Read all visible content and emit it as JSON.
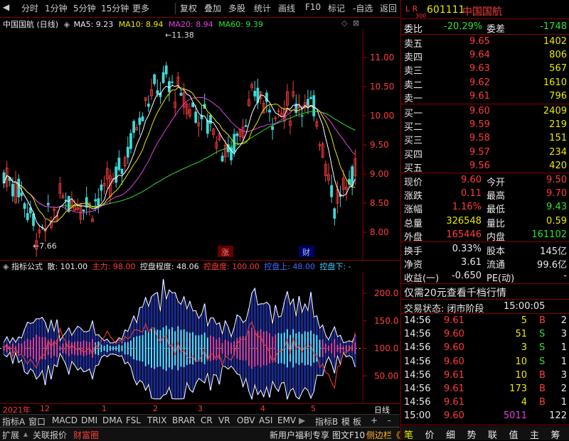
{
  "toolbar": {
    "items": [
      "分时",
      "1分钟",
      "5分钟",
      "15分钟",
      "更多",
      "复权",
      "叠加",
      "多股",
      "统计",
      "画线",
      "F10",
      "标记",
      "-自选",
      "返回"
    ]
  },
  "main_chart": {
    "title": "中国国航 (日线)",
    "ma5_label": "MA5: 9.23",
    "ma10_label": "MA10: 8.94",
    "ma20_label": "MA20: 8.94",
    "ma60_label": "MA60: 9.39",
    "high_marker": "11.38",
    "low_marker": "7.66",
    "y_ticks": [
      "11.00",
      "10.50",
      "10.00",
      "9.50",
      "9.00",
      "8.50",
      "8.00"
    ],
    "event_labels": [
      "涨",
      "财"
    ]
  },
  "indicator": {
    "name": "指标公式",
    "san_label": "散: 101.00",
    "zhuli_label": "主力: 98.00",
    "kongpan_label": "控盘程度: 48.06",
    "kongpandu_label": "控盘度: 100.00",
    "kongpanshang_label": "控盘上: 48.00",
    "kongpanxia_label": "控盘下: -",
    "y_ticks": [
      "200.0",
      "150.0",
      "100.0",
      "50.00"
    ]
  },
  "date_axis": {
    "year": "2021年",
    "months": [
      "12",
      "1",
      "2",
      "3",
      "4",
      "5"
    ],
    "unit": "日线"
  },
  "indicator_tabs": [
    "指标A",
    "窗口",
    "MACD",
    "DMI",
    "DMA",
    "FSL",
    "TRIX",
    "BRAR",
    "CR",
    "VR",
    "OBV",
    "ASI",
    "EMV",
    "指标B",
    "模",
    "板",
    "+",
    "-"
  ],
  "bottom_tabs": [
    "扩展",
    "关联报价",
    "财富圈"
  ],
  "bottom_right_links": [
    "新用户福利专享",
    "图文F10",
    "侧边栏《"
  ],
  "quote": {
    "lr_tag": "L R",
    "index_code": "300",
    "code": "601111",
    "name": "中国国航",
    "weibi_label": "委比",
    "weibi_value": "-20.29%",
    "weicha_label": "委差",
    "weicha_value": "-1748",
    "asks": [
      {
        "label": "卖五",
        "price": "9.65",
        "vol": "1402"
      },
      {
        "label": "卖四",
        "price": "9.64",
        "vol": "806"
      },
      {
        "label": "卖三",
        "price": "9.63",
        "vol": "567"
      },
      {
        "label": "卖二",
        "price": "9.62",
        "vol": "1610"
      },
      {
        "label": "卖一",
        "price": "9.61",
        "vol": "796"
      }
    ],
    "bids": [
      {
        "label": "买一",
        "price": "9.60",
        "vol": "2409"
      },
      {
        "label": "买二",
        "price": "9.59",
        "vol": "219"
      },
      {
        "label": "买三",
        "price": "9.58",
        "vol": "151"
      },
      {
        "label": "买四",
        "price": "9.57",
        "vol": "234"
      },
      {
        "label": "买五",
        "price": "9.56",
        "vol": "420"
      }
    ],
    "stats": [
      {
        "l1": "现价",
        "v1": "9.60",
        "l2": "今开",
        "v2": "9.50"
      },
      {
        "l1": "涨跌",
        "v1": "0.11",
        "l2": "最高",
        "v2": "9.70"
      },
      {
        "l1": "涨幅",
        "v1": "1.16%",
        "l2": "最低",
        "v2": "9.43"
      },
      {
        "l1": "总量",
        "v1": "326548",
        "l2": "量比",
        "v2": "0.59"
      },
      {
        "l1": "外盘",
        "v1": "165446",
        "l2": "内盘",
        "v2": "161102"
      }
    ],
    "fin": [
      {
        "l1": "换手",
        "v1": "0.33%",
        "l2": "股本",
        "v2": "145亿"
      },
      {
        "l1": "净资",
        "v1": "3.61",
        "l2": "流通",
        "v2": "99.6亿"
      },
      {
        "l1": "收益(一)",
        "v1": "-0.650",
        "l2": "PE(动)",
        "v2": "-"
      }
    ],
    "promo": "仅需20元查看千档行情",
    "status_label": "交易状态: 闭市阶段",
    "status_time": "15:00:05",
    "ticks": [
      {
        "t": "14:56",
        "p": "9.61",
        "v": "5",
        "s": "B",
        "n": "2"
      },
      {
        "t": "14:56",
        "p": "9.60",
        "v": "51",
        "s": "S",
        "n": "3"
      },
      {
        "t": "14:56",
        "p": "9.60",
        "v": "3",
        "s": "S",
        "n": "1"
      },
      {
        "t": "14:56",
        "p": "9.60",
        "v": "10",
        "s": "S",
        "n": "1"
      },
      {
        "t": "14:56",
        "p": "9.61",
        "v": "10",
        "s": "B",
        "n": "3"
      },
      {
        "t": "14:56",
        "p": "9.61",
        "v": "173",
        "s": "B",
        "n": "2"
      },
      {
        "t": "14:56",
        "p": "9.61",
        "v": "4",
        "s": "B",
        "n": "1"
      },
      {
        "t": "15:00",
        "p": "9.60",
        "v": "5011",
        "s": "",
        "n": "122"
      }
    ],
    "bottom_tabs": [
      "笔",
      "价",
      "细",
      "势",
      "联",
      "值",
      "主",
      "筹"
    ]
  },
  "colors": {
    "up": "#ff3c3c",
    "down": "#3fd8d8",
    "ma5": "#ffffff",
    "ma10": "#e8e800",
    "ma20": "#e040e0",
    "ma60": "#2fe02f"
  }
}
